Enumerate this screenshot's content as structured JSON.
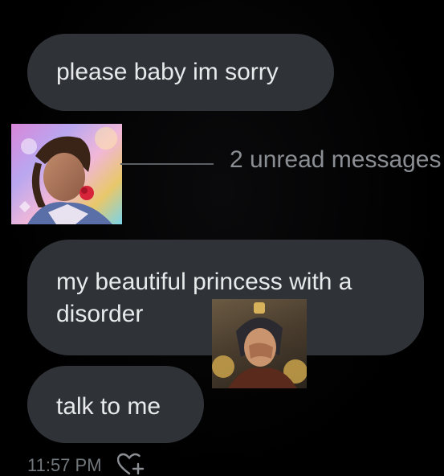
{
  "messages": [
    {
      "text": "please baby im sorry"
    },
    {
      "text": "my beautiful princess with a disorder"
    },
    {
      "text": "talk to me"
    }
  ],
  "unread_divider": {
    "label": "2 unread messages"
  },
  "timestamp": "11:57 PM",
  "icons": {
    "reaction": "heart-plus-icon",
    "avatar": "anime-avatar-image",
    "sticker": "anime-facepalm-sticker"
  },
  "colors": {
    "background": "#000000",
    "bubble": "#2f3338",
    "bubble_text": "#e7e9ea",
    "muted_text": "#8b8f94"
  }
}
